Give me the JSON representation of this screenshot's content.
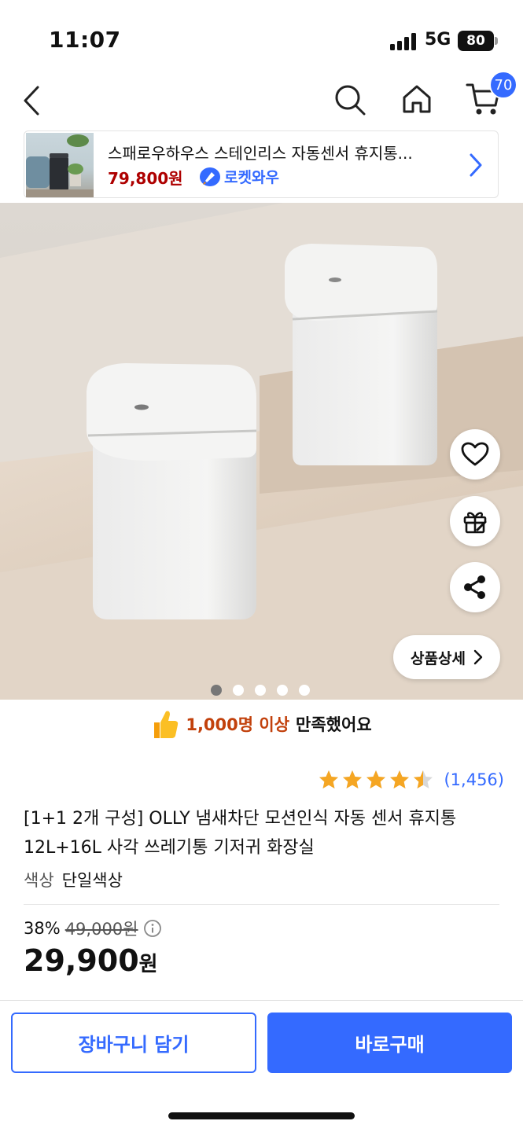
{
  "status_bar": {
    "time": "11:07",
    "network": "5G",
    "battery": "80"
  },
  "nav": {
    "cart_count": "70"
  },
  "banner": {
    "title": "스패로우하우스 스테인리스 자동센서 휴지통...",
    "price": "79,800원",
    "rocket_label": "로켓와우"
  },
  "image": {
    "detail_button": "상품상세",
    "carousel_total": 5,
    "carousel_active": 1
  },
  "satisfaction": {
    "highlight": "1,000명 이상",
    "rest": "만족했어요"
  },
  "rating": {
    "stars": 4.5,
    "count": "(1,456)"
  },
  "product": {
    "title": "[1+1 2개 구성] OLLY 냄새차단 모션인식 자동 센서 휴지통 12L+16L 사각 쓰레기통 기저귀 화장실",
    "option_label": "색상",
    "option_value": "단일색상",
    "discount": "38%",
    "original_price": "49,000원",
    "price_number": "29,900",
    "price_unit": "원"
  },
  "actions": {
    "cart": "장바구니 담기",
    "buy": "바로구매"
  },
  "colors": {
    "accent": "#346aff",
    "price_red": "#ae0000",
    "star": "#f5a623"
  }
}
